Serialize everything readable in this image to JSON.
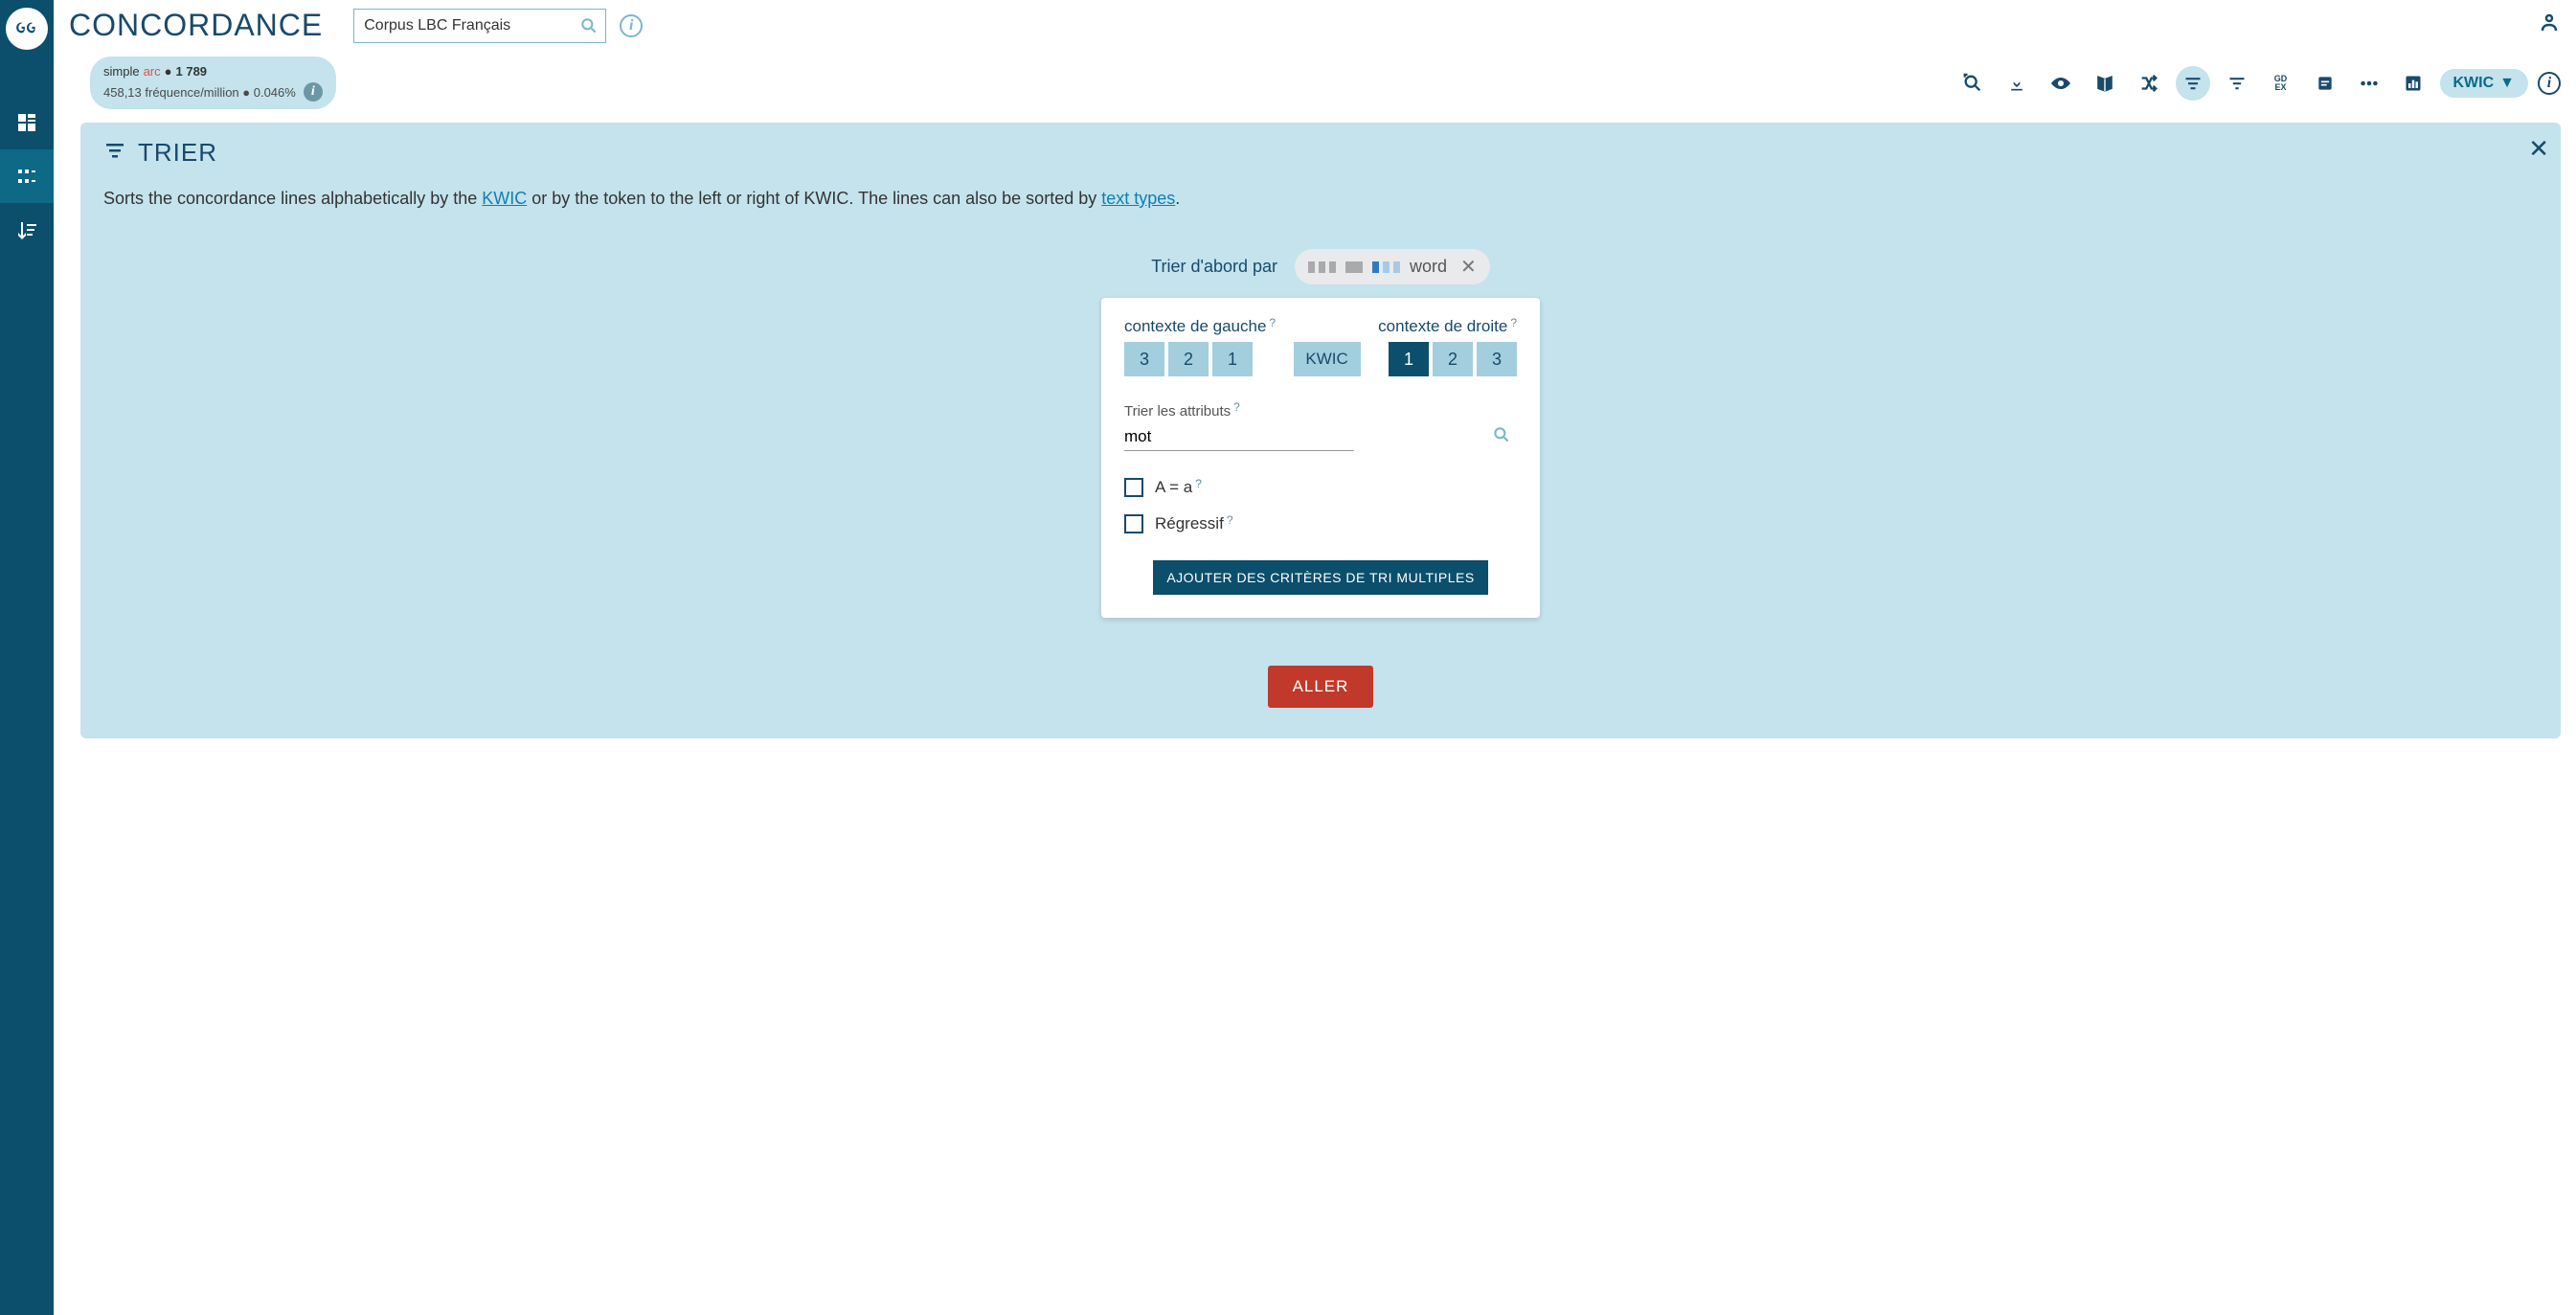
{
  "app_title": "CONCORDANCE",
  "corpus_search": {
    "value": "Corpus LBC Français"
  },
  "query_pill": {
    "type": "simple",
    "term": "arc",
    "count": "1 789",
    "freq": "458,13 fréquence/million",
    "pct": "0.046%"
  },
  "toolbar": {
    "gdex_line1": "GD",
    "gdex_line2": "EX",
    "kwic_label": "KWIC"
  },
  "panel": {
    "title": "TRIER",
    "desc_pre": "Sorts the concordance lines alphabetically by the ",
    "kwic_link": "KWIC",
    "desc_mid": " or by the token to the left or right of KWIC. The lines can also be sorted by ",
    "tt_link": "text types",
    "desc_post": ".",
    "sort_first_label": "Trier d'abord par",
    "chip_word": "word"
  },
  "card": {
    "left_label": "contexte de gauche",
    "right_label": "contexte de droite",
    "left_buttons": [
      "3",
      "2",
      "1"
    ],
    "right_buttons": [
      "1",
      "2",
      "3"
    ],
    "kwic_label": "KWIC",
    "selected_right": "1",
    "attr_label": "Trier les attributs",
    "attr_value": "mot",
    "case_label": "A = a",
    "regress_label": "Régressif",
    "add_button": "AJOUTER DES CRITÈRES DE TRI MULTIPLES"
  },
  "go_button": "ALLER"
}
